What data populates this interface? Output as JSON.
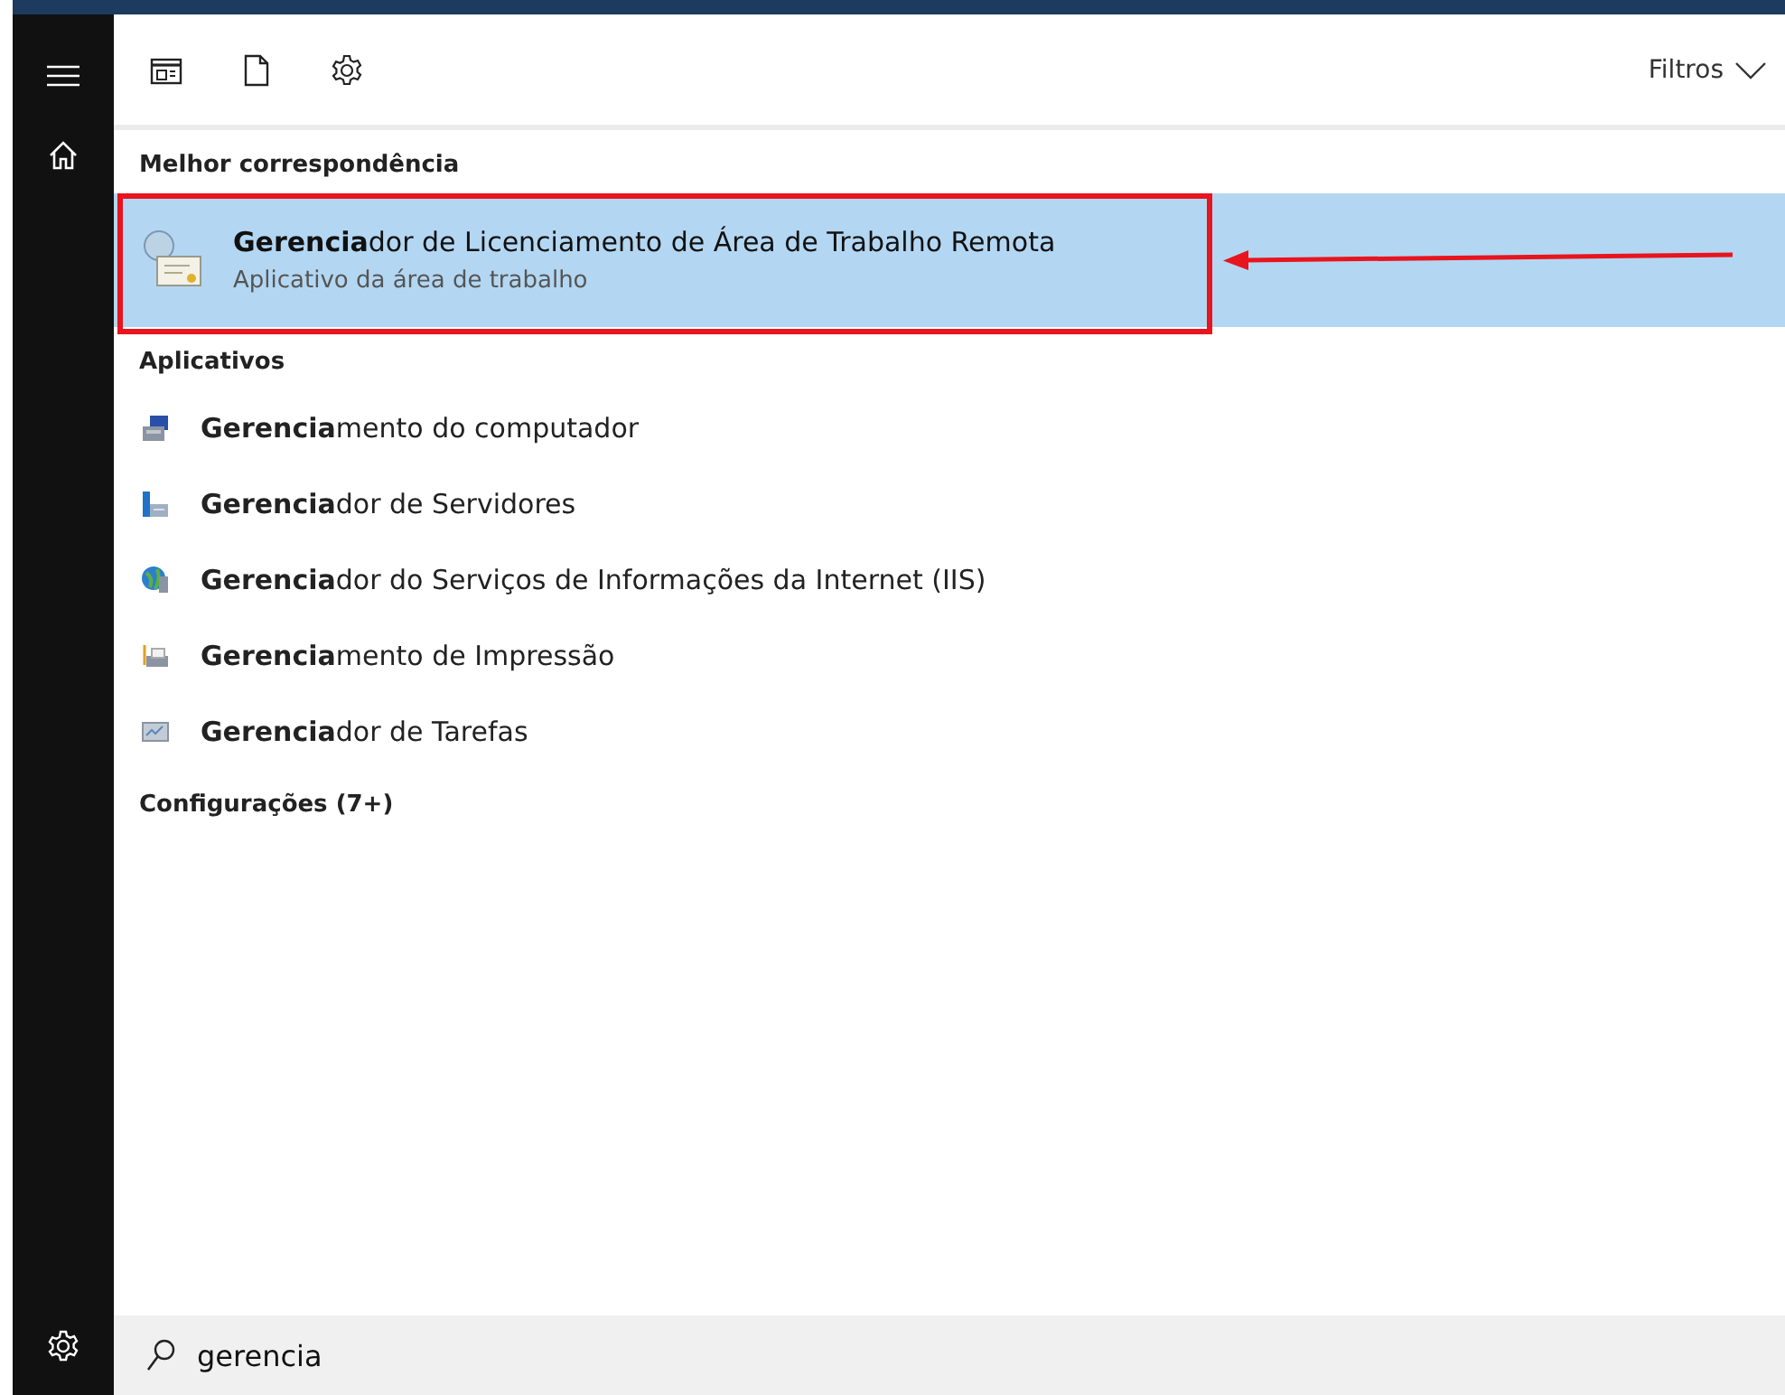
{
  "toolbar": {
    "filters_label": "Filtros"
  },
  "best_match": {
    "heading": "Melhor correspondência",
    "item": {
      "title": "**Gerencia**dor de Licenciamento de Área de Trabalho Remota",
      "subtitle": "Aplicativo da área de trabalho",
      "selected": true
    }
  },
  "apps": {
    "heading": "Aplicativos",
    "items": [
      {
        "title": "**Gerencia**mento do computador",
        "kind": "computer"
      },
      {
        "title": "**Gerencia**dor de Servidores",
        "kind": "servers"
      },
      {
        "title": "**Gerencia**dor do Serviços de Informações da Internet (IIS)",
        "kind": "globe"
      },
      {
        "title": "**Gerencia**mento de Impressão",
        "kind": "printer"
      },
      {
        "title": "**Gerencia**dor de Tarefas",
        "kind": "monitor"
      }
    ]
  },
  "settings": {
    "heading": "Configurações (7+)"
  },
  "search": {
    "value": "gerencia"
  }
}
